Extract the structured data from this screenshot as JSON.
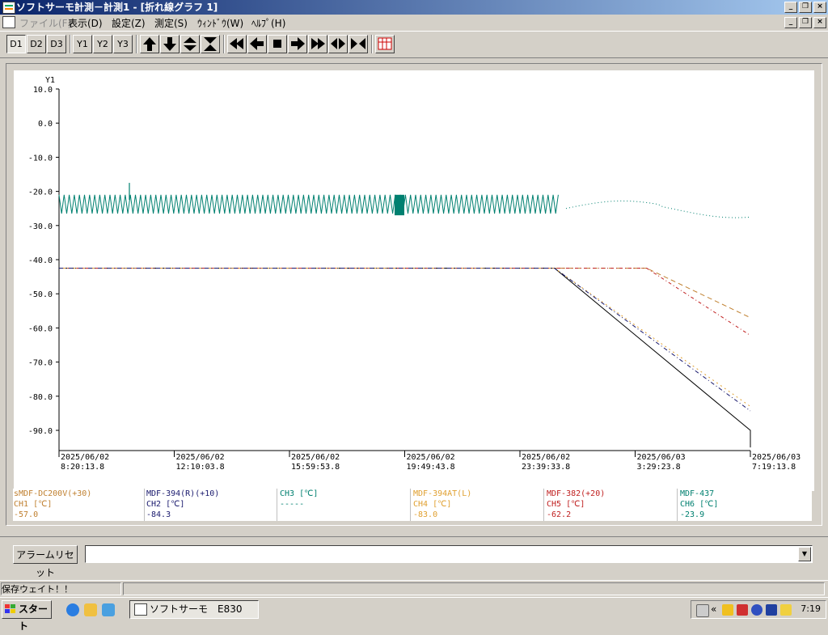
{
  "window": {
    "title": "ソフトサーモ計測－計測1 - [折れ線グラフ 1]",
    "min": "_",
    "max": "□",
    "close": "×",
    "restore": "❐"
  },
  "menu": [
    "ファイル(F)",
    "表示(D)",
    "設定(Z)",
    "測定(S)",
    "ｳｨﾝﾄﾞｳ(W)",
    "ﾍﾙﾌﾟ(H)"
  ],
  "toolbar": {
    "d_buttons": [
      "D1",
      "D2",
      "D3"
    ],
    "y_buttons": [
      "Y1",
      "Y2",
      "Y3"
    ],
    "nav_icons": [
      "arrow-up-icon",
      "arrow-down-icon",
      "expand-vertical-icon",
      "shrink-vertical-icon",
      "rewind-icon",
      "step-back-icon",
      "stop-icon",
      "step-forward-icon",
      "fast-forward-icon",
      "zoom-horizontal-icon",
      "shrink-horizontal-icon",
      "table-icon"
    ]
  },
  "chart_data": {
    "type": "line",
    "axis_label": "Y1",
    "y_ticks": [
      "10.0",
      "0.0",
      "-10.0",
      "-20.0",
      "-30.0",
      "-40.0",
      "-50.0",
      "-60.0",
      "-70.0",
      "-80.0",
      "-90.0"
    ],
    "ylim": [
      -95,
      10
    ],
    "x_ticks": [
      {
        "date": "2025/06/02",
        "time": "8:20:13.8"
      },
      {
        "date": "2025/06/02",
        "time": "12:10:03.8"
      },
      {
        "date": "2025/06/02",
        "time": "15:59:53.8"
      },
      {
        "date": "2025/06/02",
        "time": "19:49:43.8"
      },
      {
        "date": "2025/06/02",
        "time": "23:39:33.8"
      },
      {
        "date": "2025/06/03",
        "time": "3:29:23.8"
      },
      {
        "date": "2025/06/03",
        "time": "7:19:13.8"
      }
    ],
    "colors": {
      "ch1": "#c08030",
      "ch2": "#1a1a6e",
      "ch4": "#e0a030",
      "ch5": "#c02020",
      "ch6": "#008070",
      "base": "#000000"
    },
    "series": [
      {
        "name": "CH6",
        "style": "oscillating",
        "x": [
          0.0,
          3.7,
          4.4,
          5.2,
          5.8,
          6.0
        ],
        "y": [
          -23,
          -23,
          -25,
          -23,
          -27,
          -24
        ]
      },
      {
        "name": "CH1",
        "x": [
          0.0,
          4.3,
          5.1,
          6.0
        ],
        "y": [
          -42.5,
          -42.5,
          -42.5,
          -57.0
        ]
      },
      {
        "name": "CH5",
        "x": [
          0.0,
          4.3,
          5.1,
          6.0
        ],
        "y": [
          -42.5,
          -42.5,
          -42.5,
          -62.2
        ]
      },
      {
        "name": "CH4",
        "x": [
          0.0,
          4.3,
          6.0
        ],
        "y": [
          -42.5,
          -42.5,
          -83.0
        ]
      },
      {
        "name": "CH2",
        "x": [
          0.0,
          4.3,
          6.0
        ],
        "y": [
          -42.5,
          -42.5,
          -84.3
        ]
      },
      {
        "name": "base",
        "x": [
          0.0,
          4.3,
          6.0,
          6.0
        ],
        "y": [
          -42.5,
          -42.5,
          -90.0,
          -95.0
        ]
      }
    ]
  },
  "legend": [
    {
      "name": "sMDF-DC200V(+30)",
      "ch": "CH1 [℃]",
      "value": "-57.0",
      "color": "#c08030"
    },
    {
      "name": "MDF-394(R)(+10)",
      "ch": "CH2 [℃]",
      "value": "-84.3",
      "color": "#1a1a6e"
    },
    {
      "name": "",
      "ch": "CH3 [℃]",
      "value": "-----",
      "color": "#008070"
    },
    {
      "name": "MDF-394AT(L)",
      "ch": "CH4 [℃]",
      "value": "-83.0",
      "color": "#e0a030"
    },
    {
      "name": "MDF-382(+20)",
      "ch": "CH5 [℃]",
      "value": "-62.2",
      "color": "#c02020"
    },
    {
      "name": "MDF-437",
      "ch": "CH6 [℃]",
      "value": "-23.9",
      "color": "#008070"
    }
  ],
  "alarm": {
    "reset_label": "アラームリセット",
    "combo_value": ""
  },
  "status": {
    "text": "保存ウェイト！！"
  },
  "taskbar": {
    "start": "スタート",
    "task": "ソフトサーモ　E830",
    "clock": "7:19",
    "chevron": "«"
  }
}
